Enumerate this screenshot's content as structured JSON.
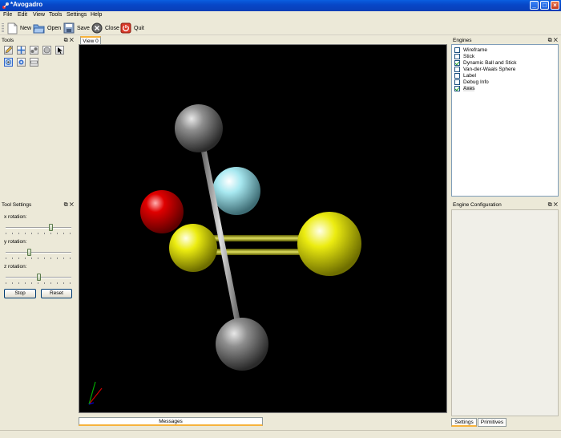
{
  "window": {
    "title": "*Avogadro"
  },
  "menu": [
    "File",
    "Edit",
    "View",
    "Tools",
    "Settings",
    "Help"
  ],
  "toolbar": {
    "new_label": "New",
    "open_label": "Open",
    "save_label": "Save",
    "close_label": "Close",
    "quit_label": "Quit"
  },
  "tools_pane": {
    "title": "Tools"
  },
  "tool_settings": {
    "title": "Tool Settings",
    "x_label": "x rotation:",
    "y_label": "y rotation:",
    "z_label": "z rotation:",
    "x_value": 0.7,
    "y_value": 0.35,
    "z_value": 0.5,
    "stop_label": "Stop",
    "reset_label": "Reset"
  },
  "view": {
    "tab_label": "View 0"
  },
  "messages": {
    "label": "Messages"
  },
  "engines": {
    "title": "Engines",
    "items": [
      {
        "label": "Wireframe",
        "checked": false
      },
      {
        "label": "Stick",
        "checked": false
      },
      {
        "label": "Dynamic Ball and Stick",
        "checked": true
      },
      {
        "label": "Van-der-Waals Sphere",
        "checked": false
      },
      {
        "label": "Label",
        "checked": false
      },
      {
        "label": "Debug Info",
        "checked": false
      },
      {
        "label": "Axes",
        "checked": true
      }
    ]
  },
  "engine_config": {
    "title": "Engine Configuration",
    "tab_settings": "Settings",
    "tab_primitives": "Primitives"
  },
  "colors": {
    "view_bg": "#000000",
    "atom_gray": "#8a8a8a",
    "atom_cyan": "#9fe4ee",
    "atom_red": "#e00000",
    "atom_yellow": "#e8e800"
  }
}
